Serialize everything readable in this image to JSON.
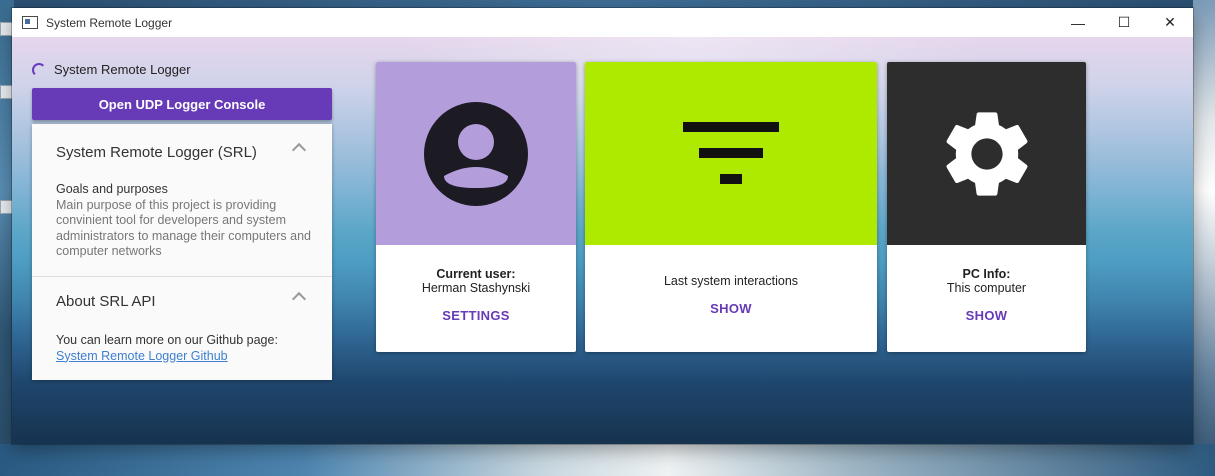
{
  "window": {
    "title": "System Remote Logger",
    "controls": {
      "minimize": "—",
      "maximize": "☐",
      "close": "✕"
    }
  },
  "brand": {
    "label": "System Remote Logger"
  },
  "primary_button": {
    "label": "Open UDP Logger Console"
  },
  "accordion": {
    "sections": [
      {
        "title": "System Remote Logger (SRL)",
        "subtitle": "Goals and purposes",
        "text": "Main purpose of this project is providing convinient tool for developers and system administrators to manage their computers and computer networks"
      },
      {
        "title": "About SRL API",
        "text": "You can learn more on our Github page:",
        "link": "System Remote Logger Github"
      }
    ]
  },
  "cards": [
    {
      "title": "Current user:",
      "value": "Herman Stashynski",
      "action": "SETTINGS",
      "icon": "account-circle-icon",
      "color": "#b39ddb"
    },
    {
      "title": "Last system interactions",
      "action": "SHOW",
      "icon": "filter-list-icon",
      "color": "#aeea00"
    },
    {
      "title": "PC Info:",
      "value": "This computer",
      "action": "SHOW",
      "icon": "settings-gear-icon",
      "color": "#2d2d2d"
    }
  ],
  "colors": {
    "accent": "#673ab7",
    "link": "#3d7fd0"
  }
}
